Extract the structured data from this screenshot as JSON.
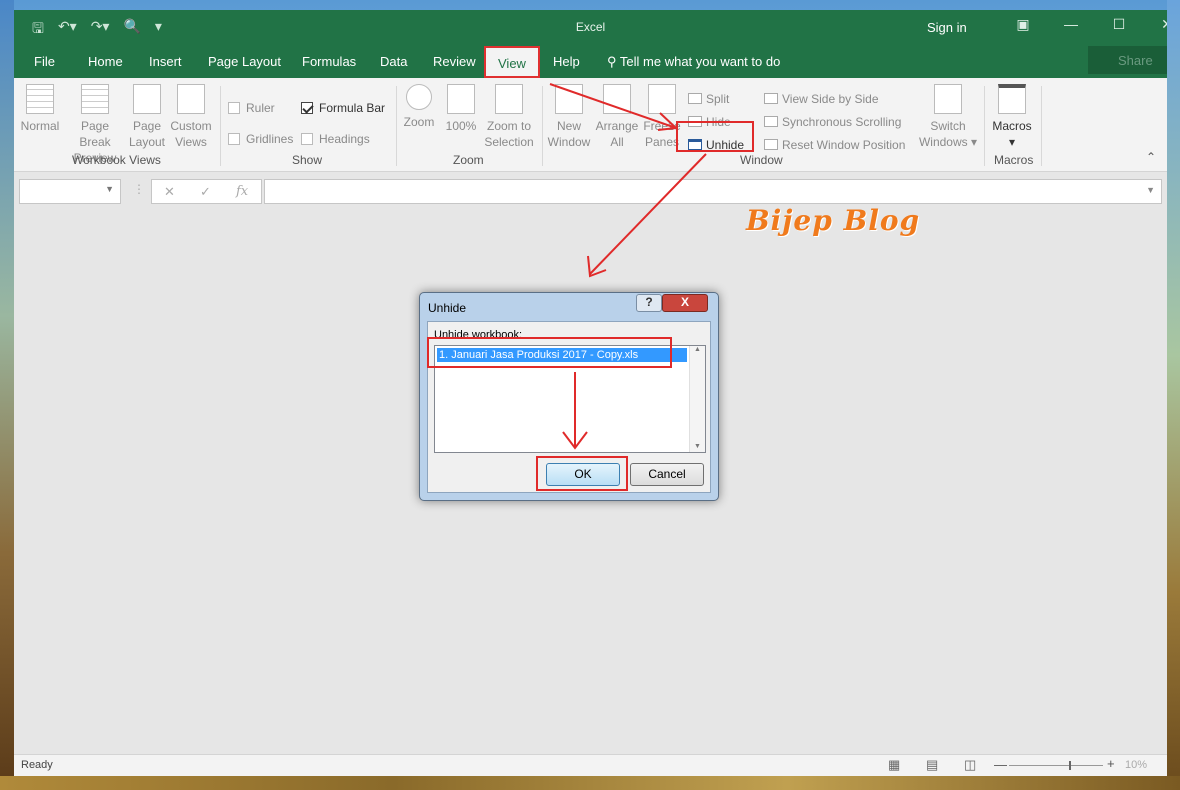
{
  "app": {
    "title": "Excel",
    "sign_in": "Sign in",
    "share": "Share"
  },
  "qat_icons": [
    "save-icon",
    "undo-icon",
    "redo-icon",
    "print-preview-icon",
    "customize-icon"
  ],
  "tabs": [
    "File",
    "Home",
    "Insert",
    "Page Layout",
    "Formulas",
    "Data",
    "Review",
    "View",
    "Help"
  ],
  "active_tab": "View",
  "tell_me": "Tell me what you want to do",
  "ribbon": {
    "workbook_views": {
      "label": "Workbook Views",
      "normal": "Normal",
      "page_break_1": "Page Break",
      "page_break_2": "Preview",
      "page_layout_1": "Page",
      "page_layout_2": "Layout",
      "custom_1": "Custom",
      "custom_2": "Views"
    },
    "show": {
      "label": "Show",
      "ruler": "Ruler",
      "formula_bar": "Formula Bar",
      "gridlines": "Gridlines",
      "headings": "Headings",
      "formula_bar_checked": true
    },
    "zoom": {
      "label": "Zoom",
      "zoom": "Zoom",
      "hundred": "100%",
      "zoom_sel_1": "Zoom to",
      "zoom_sel_2": "Selection"
    },
    "window": {
      "label": "Window",
      "new_window_1": "New",
      "new_window_2": "Window",
      "arrange_1": "Arrange",
      "arrange_2": "All",
      "freeze_1": "Freeze",
      "freeze_2": "Panes",
      "split": "Split",
      "hide": "Hide",
      "unhide": "Unhide",
      "side_by_side": "View Side by Side",
      "sync_scroll": "Synchronous Scrolling",
      "reset_pos": "Reset Window Position",
      "switch_1": "Switch",
      "switch_2": "Windows"
    },
    "macros": {
      "label": "Macros",
      "macros": "Macros"
    }
  },
  "formula_bar": {
    "fx": "fx"
  },
  "status": {
    "ready": "Ready",
    "zoom": "10%",
    "zoom_fraction": 0.1
  },
  "watermark": "Bijep Blog",
  "dialog": {
    "title": "Unhide",
    "help": "?",
    "close": "X",
    "label": "Unhide workbook:",
    "items": [
      "1. Januari Jasa Produksi 2017 - Copy.xls"
    ],
    "ok": "OK",
    "cancel": "Cancel"
  },
  "colors": {
    "excel_green": "#217346",
    "annotation_red": "#e02a2a",
    "watermark_orange": "#f07a1c"
  }
}
